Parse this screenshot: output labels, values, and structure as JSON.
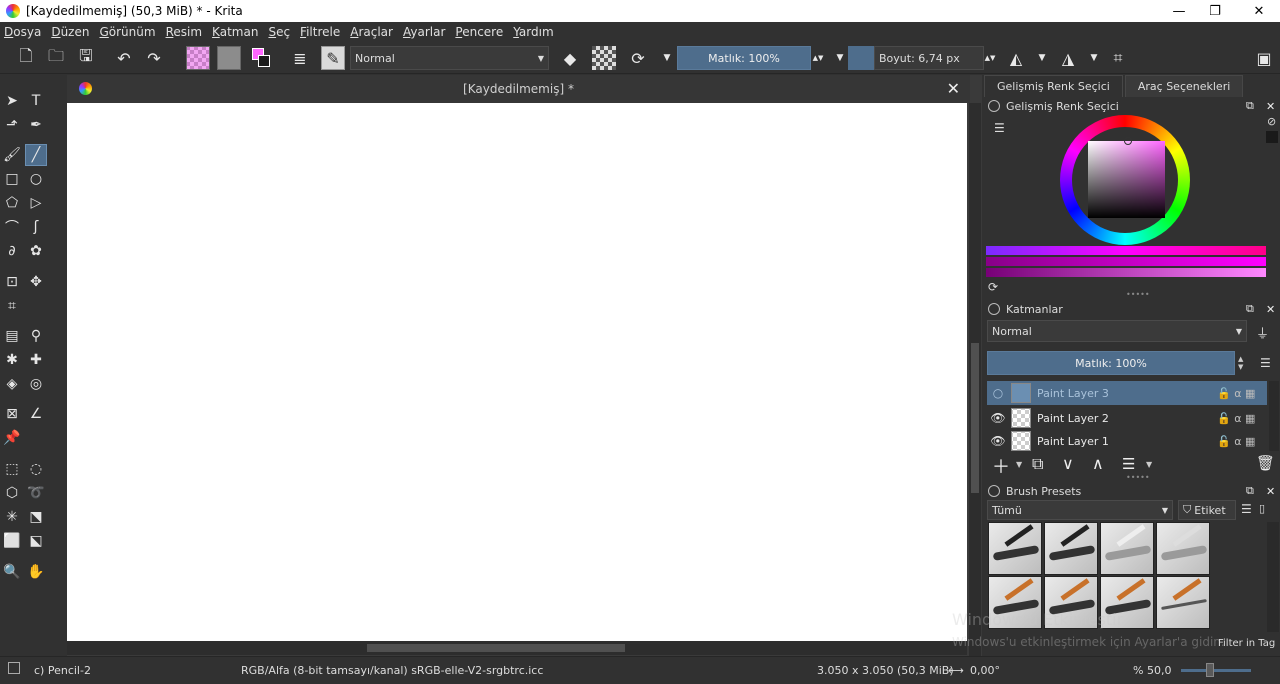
{
  "window": {
    "title": "[Kaydedilmemiş]  (50,3 MiB)  * - Krita",
    "minimize": "—",
    "maximize": "❐",
    "close": "✕"
  },
  "menu": [
    "Dosya",
    "Düzen",
    "Görünüm",
    "Resim",
    "Katman",
    "Seç",
    "Filtrele",
    "Araçlar",
    "Ayarlar",
    "Pencere",
    "Yardım"
  ],
  "toolbar": {
    "blend_mode": "Normal",
    "opacity": "Matlık: 100%",
    "size": "Boyut: 6,74 px"
  },
  "document": {
    "tab_title": "[Kaydedilmemiş]  *"
  },
  "docker": {
    "tabs": [
      "Gelişmiş Renk Seçici",
      "Araç Seçenekleri"
    ],
    "color_selector_title": "Gelişmiş Renk Seçici",
    "layers_title": "Katmanlar",
    "layers_blend": "Normal",
    "layers_opacity": "Matlık:  100%",
    "layers": [
      {
        "name": "Paint Layer 3",
        "selected": true
      },
      {
        "name": "Paint Layer 2",
        "selected": false
      },
      {
        "name": "Paint Layer 1",
        "selected": false
      }
    ],
    "brush_presets_title": "Brush Presets",
    "brush_filter": "Tümü",
    "tag_label": "Etiket",
    "filter_in_tag": "Filter in Tag"
  },
  "status": {
    "brush": "c) Pencil-2",
    "color_model": "RGB/Alfa (8-bit tamsayı/kanal)  sRGB-elle-V2-srgbtrc.icc",
    "dimensions": "3.050 x 3.050 (50,3 MiB)",
    "rotation": "0,00°",
    "zoom": "% 50,0"
  },
  "watermark": {
    "line1": "Windows'u Etkinleştir",
    "line2": "Windows'u etkinleştirmek için Ayarlar'a gidin."
  },
  "colors": {
    "accent": "#4e6d8c",
    "foreground": "#ff66ff",
    "background": "#1a1a1a"
  }
}
